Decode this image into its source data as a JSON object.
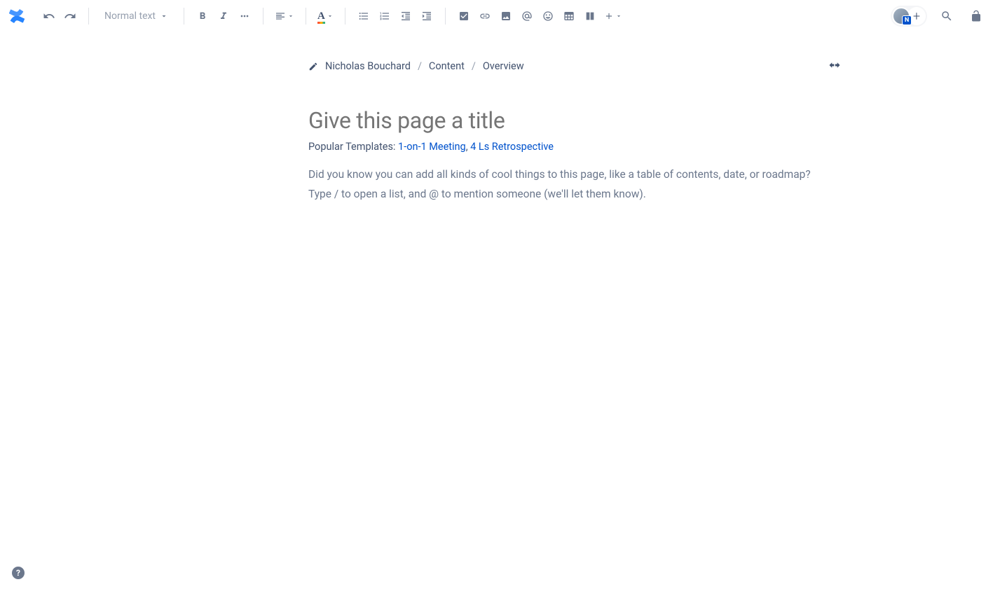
{
  "toolbar": {
    "text_style_label": "Normal text"
  },
  "breadcrumb": {
    "items": [
      "Nicholas Bouchard",
      "Content",
      "Overview"
    ]
  },
  "page": {
    "title_placeholder": "Give this page a title",
    "templates_label": "Popular Templates: ",
    "templates": [
      "1-on-1 Meeting",
      "4 Ls Retrospective"
    ],
    "body_hint_line1": "Did you know you can add all kinds of cool things to this page, like a table of contents, date, or roadmap?",
    "body_hint_line2": "Type / to open a list, and @ to mention someone (we'll let them know)."
  },
  "avatar": {
    "badge": "N"
  },
  "help": {
    "label": "?"
  }
}
